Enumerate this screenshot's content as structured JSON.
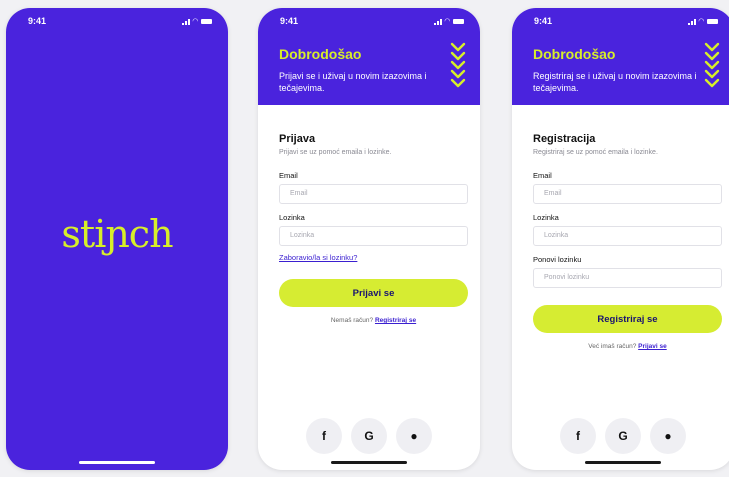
{
  "status_time": "9:41",
  "splash": {
    "logo": "stiɲch"
  },
  "login": {
    "header_title": "Dobrodošao",
    "header_sub": "Prijavi se i uživaj u novim izazovima i tečajevima.",
    "title": "Prijava",
    "subtitle": "Prijavi se uz pomoć emaila i lozinke.",
    "email_label": "Email",
    "email_placeholder": "Email",
    "password_label": "Lozinka",
    "password_placeholder": "Lozinka",
    "forgot": "Zaboravio/la si lozinku?",
    "button": "Prijavi se",
    "alt_text": "Nemaš račun?",
    "alt_link": "Registriraj se"
  },
  "register": {
    "header_title": "Dobrodošao",
    "header_sub": "Registriraj se i uživaj u novim izazovima i tečajevima.",
    "title": "Registracija",
    "subtitle": "Registriraj se uz pomoć emaila i lozinke.",
    "email_label": "Email",
    "email_placeholder": "Email",
    "password_label": "Lozinka",
    "password_placeholder": "Lozinka",
    "repeat_label": "Ponovi lozinku",
    "repeat_placeholder": "Ponovi lozinku",
    "button": "Registriraj se",
    "alt_text": "Već imaš račun?",
    "alt_link": "Prijavi se"
  },
  "social": {
    "facebook": "f",
    "google": "G",
    "apple": "●"
  },
  "icons": [
    "signal-icon",
    "wifi-icon",
    "battery-icon",
    "chevrons-icon",
    "facebook-icon",
    "google-icon",
    "apple-icon"
  ],
  "colors": {
    "primary": "#4a23dd",
    "accent": "#d6ec32",
    "link": "#3a1fd0"
  }
}
